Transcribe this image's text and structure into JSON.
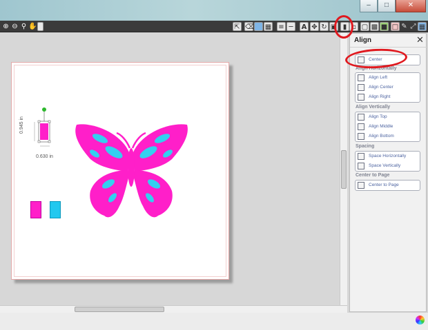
{
  "toolbar": {
    "icons": [
      "zoom-in-icon",
      "zoom-out-icon",
      "zoom-fit-icon",
      "pan-icon",
      "page-icon"
    ]
  },
  "canvas": {
    "selected_shape": {
      "height_label": "0.945 in",
      "width_label": "0.630 in",
      "fill": "#ff1fc9"
    },
    "swatches": [
      "#ff1fc9",
      "#22c8ef"
    ],
    "butterfly": {
      "wing_color": "#ff1fc9",
      "spot_color": "#33d0f0"
    }
  },
  "panel": {
    "title": "Align",
    "center_label": "Center",
    "align_horizontally": {
      "title": "Align Horizontally",
      "items": [
        "Align Left",
        "Align Center",
        "Align Right"
      ]
    },
    "align_vertically": {
      "title": "Align Vertically",
      "items": [
        "Align Top",
        "Align Middle",
        "Align Bottom"
      ]
    },
    "spacing": {
      "title": "Spacing",
      "items": [
        "Space Horizontally",
        "Space Vertically"
      ]
    },
    "center_to_page": {
      "title": "Center to Page",
      "items": [
        "Center to Page"
      ]
    }
  },
  "colors": {
    "annotation": "#e0191f",
    "toolbar_bg": "#3b3b3b"
  }
}
